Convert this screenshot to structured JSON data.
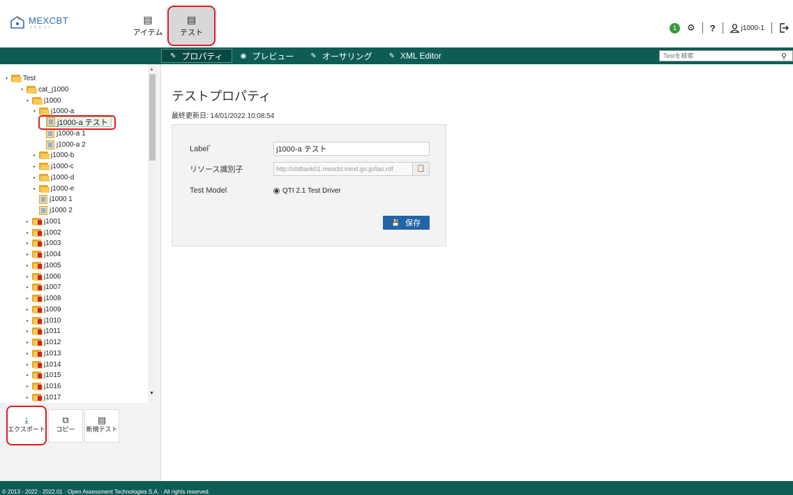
{
  "header": {
    "logo_text": "MEXCBT",
    "logo_subtext": "メクビット",
    "nav": [
      {
        "label": "アイテム",
        "icon": "book-icon"
      },
      {
        "label": "テスト",
        "icon": "book-icon"
      }
    ],
    "notification_count": "1",
    "help_label": "?",
    "user_label": "j1000-1"
  },
  "actionbar": {
    "tabs": [
      {
        "label": "プロパティ",
        "icon": "pencil-icon"
      },
      {
        "label": "プレビュー",
        "icon": "eye-icon"
      },
      {
        "label": "オーサリング",
        "icon": "pencil-icon"
      },
      {
        "label": "XML Editor",
        "icon": "pencil-icon"
      }
    ],
    "search_placeholder": "Testを検索"
  },
  "tree": {
    "nodes": [
      {
        "label": "Test"
      },
      {
        "label": "cat_j1000"
      },
      {
        "label": "j1000"
      },
      {
        "label": "j1000-a"
      },
      {
        "label": "j1000-a テスト"
      },
      {
        "label": "j1000-a 1"
      },
      {
        "label": "j1000-a 2"
      },
      {
        "label": "j1000-b"
      },
      {
        "label": "j1000-c"
      },
      {
        "label": "j1000-d"
      },
      {
        "label": "j1000-e"
      },
      {
        "label": "j1000 1"
      },
      {
        "label": "j1000 2"
      },
      {
        "label": "j1001"
      },
      {
        "label": "j1002"
      },
      {
        "label": "j1003"
      },
      {
        "label": "j1004"
      },
      {
        "label": "j1005"
      },
      {
        "label": "j1006"
      },
      {
        "label": "j1007"
      },
      {
        "label": "j1008"
      },
      {
        "label": "j1009"
      },
      {
        "label": "j1010"
      },
      {
        "label": "j1011"
      },
      {
        "label": "j1012"
      },
      {
        "label": "j1013"
      },
      {
        "label": "j1014"
      },
      {
        "label": "j1015"
      },
      {
        "label": "j1016"
      },
      {
        "label": "j1017"
      }
    ]
  },
  "sidebar_actions": [
    {
      "label": "エクスポート",
      "icon": "export-icon"
    },
    {
      "label": "コピー",
      "icon": "copy-icon"
    },
    {
      "label": "新規テスト",
      "icon": "new-test-icon"
    }
  ],
  "main": {
    "title": "テストプロパティ",
    "last_updated": "最終更新日: 14/01/2022 10:08:54",
    "form": {
      "label_label": "Label",
      "label_required": "*",
      "label_value": "j1000-a テスト",
      "resource_label": "リソース識別子",
      "resource_value": "http://cbtbank01.mexcbt.mext.go.jp/tao.rdf",
      "model_label": "Test Model",
      "model_value": "QTI 2.1 Test Driver",
      "save_label": "保存"
    }
  },
  "footer": {
    "text": "© 2013 - 2022 · 2022.01 · Open Assessment Technologies S.A. · All rights reserved."
  },
  "colors": {
    "accent_bar": "#0e5d55",
    "save_button": "#2264a8",
    "highlight": "#e01b1b"
  }
}
